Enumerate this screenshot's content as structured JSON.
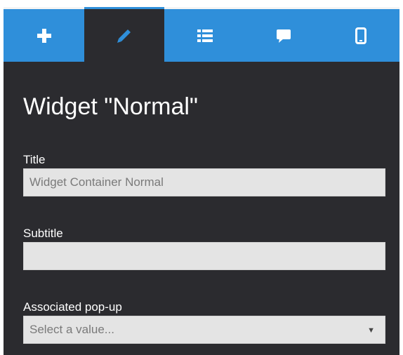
{
  "toolbar": {
    "tabs": [
      {
        "icon": "plus-icon",
        "active": false
      },
      {
        "icon": "pencil-icon",
        "active": true
      },
      {
        "icon": "list-icon",
        "active": false
      },
      {
        "icon": "speech-bubble-icon",
        "active": false
      },
      {
        "icon": "mobile-phone-icon",
        "active": false
      }
    ],
    "accent_color": "#2f8fda",
    "panel_color": "#2b2b2f"
  },
  "editor": {
    "heading": "Widget \"Normal\"",
    "title_label": "Title",
    "title_value": "Widget Container Normal",
    "subtitle_label": "Subtitle",
    "subtitle_value": "",
    "popup_label": "Associated pop-up",
    "popup_selected": "Select a value...",
    "popup_arrow": "▼"
  }
}
